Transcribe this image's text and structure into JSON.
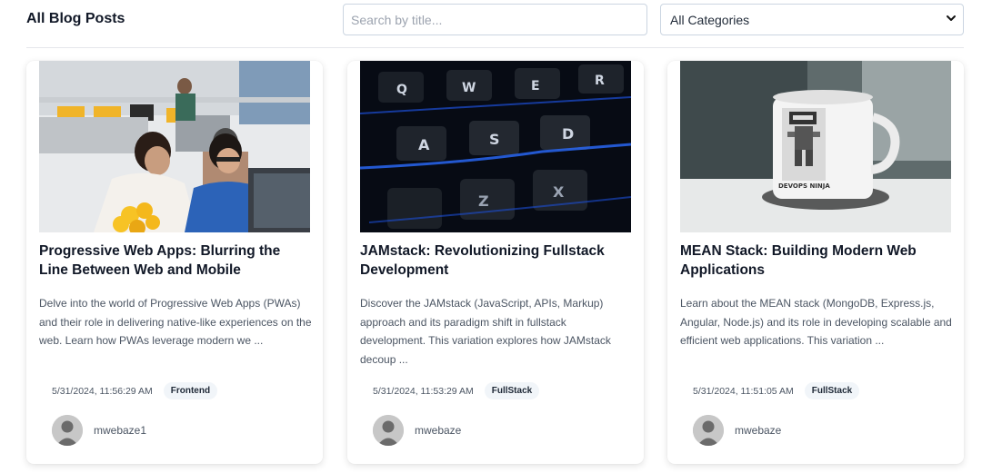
{
  "header": {
    "title": "All Blog Posts",
    "search_placeholder": "Search by title...",
    "category_selected": "All Categories",
    "category_options": [
      "All Categories"
    ]
  },
  "posts": [
    {
      "title": "Progressive Web Apps: Blurring the Line Between Web and Mobile",
      "excerpt": "Delve into the world of Progressive Web Apps (PWAs) and their role in delivering native-like experiences on the web. Learn how PWAs leverage modern we ...",
      "date": "5/31/2024, 11:56:29 AM",
      "category": "Frontend",
      "author": "mwebaze1"
    },
    {
      "title": "JAMstack: Revolutionizing Fullstack Development",
      "excerpt": "Discover the JAMstack (JavaScript, APIs, Markup) approach and its paradigm shift in fullstack development. This variation explores how JAMstack decoup ...",
      "date": "5/31/2024, 11:53:29 AM",
      "category": "FullStack",
      "author": "mwebaze"
    },
    {
      "title": "MEAN Stack: Building Modern Web Applications",
      "excerpt": "Learn about the MEAN stack (MongoDB, Express.js, Angular, Node.js) and its role in developing scalable and efficient web applications. This variation ...",
      "date": "5/31/2024, 11:51:05 AM",
      "category": "FullStack",
      "author": "mwebaze"
    }
  ],
  "images": {
    "keyboard_keys": [
      "Q",
      "W",
      "E",
      "R",
      "A",
      "S",
      "D",
      "Z",
      "X"
    ],
    "mug_print": "DEVOPS NINJA"
  },
  "colors": {
    "badge_bg": "#f1f5f9",
    "border": "#cbd5e1"
  }
}
